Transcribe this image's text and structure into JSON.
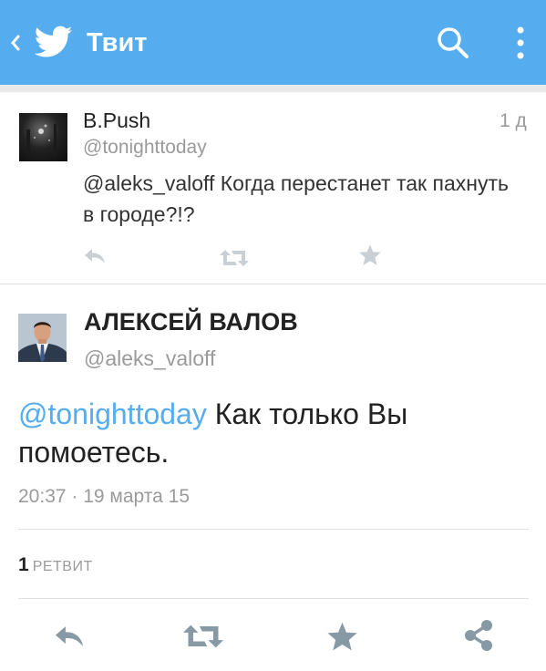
{
  "header": {
    "title": "Твит",
    "back_icon": "chevron-left-icon",
    "logo_icon": "twitter-bird-icon",
    "search_icon": "search-icon",
    "menu_icon": "more-vertical-icon",
    "bg_color": "#55acee"
  },
  "reply_tweet": {
    "name": "B.Push",
    "handle": "@tonighttoday",
    "time": "1 д",
    "text": "@aleks_valoff Когда перестанет так пахнуть в городе?!?",
    "actions": [
      "reply-icon",
      "retweet-icon",
      "favorite-icon"
    ]
  },
  "main_tweet": {
    "name": "АЛЕКСЕЙ ВАЛОВ",
    "handle": "@aleks_valoff",
    "mention": "@tonighttoday",
    "text": " Как только Вы помоетесь.",
    "timestamp": "20:37 · 19 марта 15",
    "retweet_count": "1",
    "retweet_label": "РЕТВИТ",
    "actions": [
      "reply-icon",
      "retweet-icon",
      "favorite-icon",
      "share-icon"
    ],
    "link_color": "#55acee"
  }
}
